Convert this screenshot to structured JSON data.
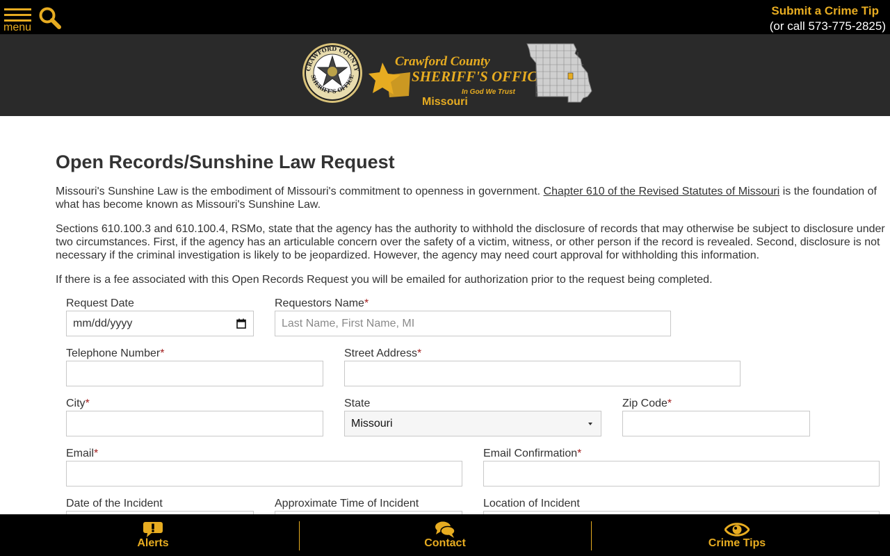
{
  "topbar": {
    "menu_label": "menu",
    "crime_tip_title": "Submit a Crime Tip",
    "crime_tip_phone": "(or call 573-775-2825)"
  },
  "banner": {
    "seal_text_top": "CRAWFORD COUNTY",
    "seal_text_bottom": "SHERIFF'S OFFICE",
    "logo_line1": "Crawford County",
    "logo_line2": "SHERIFF'S OFFICE",
    "logo_motto": "In God We Trust",
    "logo_state": "Missouri"
  },
  "page": {
    "title": "Open Records/Sunshine Law Request",
    "intro_before_link": "Missouri's Sunshine Law is the embodiment of Missouri's commitment to openness in government. ",
    "intro_link": "Chapter 610 of the Revised Statutes of Missouri",
    "intro_after_link": " is the foundation of what has become known as Missouri's Sunshine Law.",
    "sections_paragraph": "Sections 610.100.3 and 610.100.4, RSMo, state that the agency has the authority to withhold the disclosure of records that may otherwise be subject to disclosure under two circumstances. First, if the agency has an articulable concern over the safety of a victim, witness, or other person if the record is revealed. Second, disclosure is not necessary if the criminal investigation is likely to be jeopardized. However, the agency may need court approval for withholding this information.",
    "fee_paragraph": "If there is a fee associated with this Open Records Request you will be emailed for authorization prior to the request being completed."
  },
  "form": {
    "required_mark": "*",
    "request_date": {
      "label": "Request Date",
      "placeholder": "mm/dd/yyyy"
    },
    "requestors_name": {
      "label": "Requestors Name",
      "placeholder": "Last Name, First Name, MI"
    },
    "telephone": {
      "label": "Telephone Number"
    },
    "street_address": {
      "label": "Street Address"
    },
    "city": {
      "label": "City"
    },
    "state": {
      "label": "State",
      "value": "Missouri"
    },
    "zip": {
      "label": "Zip Code"
    },
    "email": {
      "label": "Email"
    },
    "email_confirmation": {
      "label": "Email Confirmation"
    },
    "incident_date": {
      "label": "Date of the Incident"
    },
    "incident_time": {
      "label": "Approximate Time of Incident"
    },
    "incident_location": {
      "label": "Location of Incident"
    }
  },
  "bottombar": {
    "alerts": "Alerts",
    "contact": "Contact",
    "crime_tips": "Crime Tips"
  },
  "colors": {
    "accent": "#e7ac21",
    "required": "#a11d1d",
    "bar_bg": "#000000",
    "banner_bg": "#2a2a2a"
  },
  "icons": [
    "menu-icon",
    "search-icon",
    "alert-icon",
    "chat-icon",
    "eye-icon",
    "calendar-icon",
    "dropdown-arrow-icon"
  ]
}
